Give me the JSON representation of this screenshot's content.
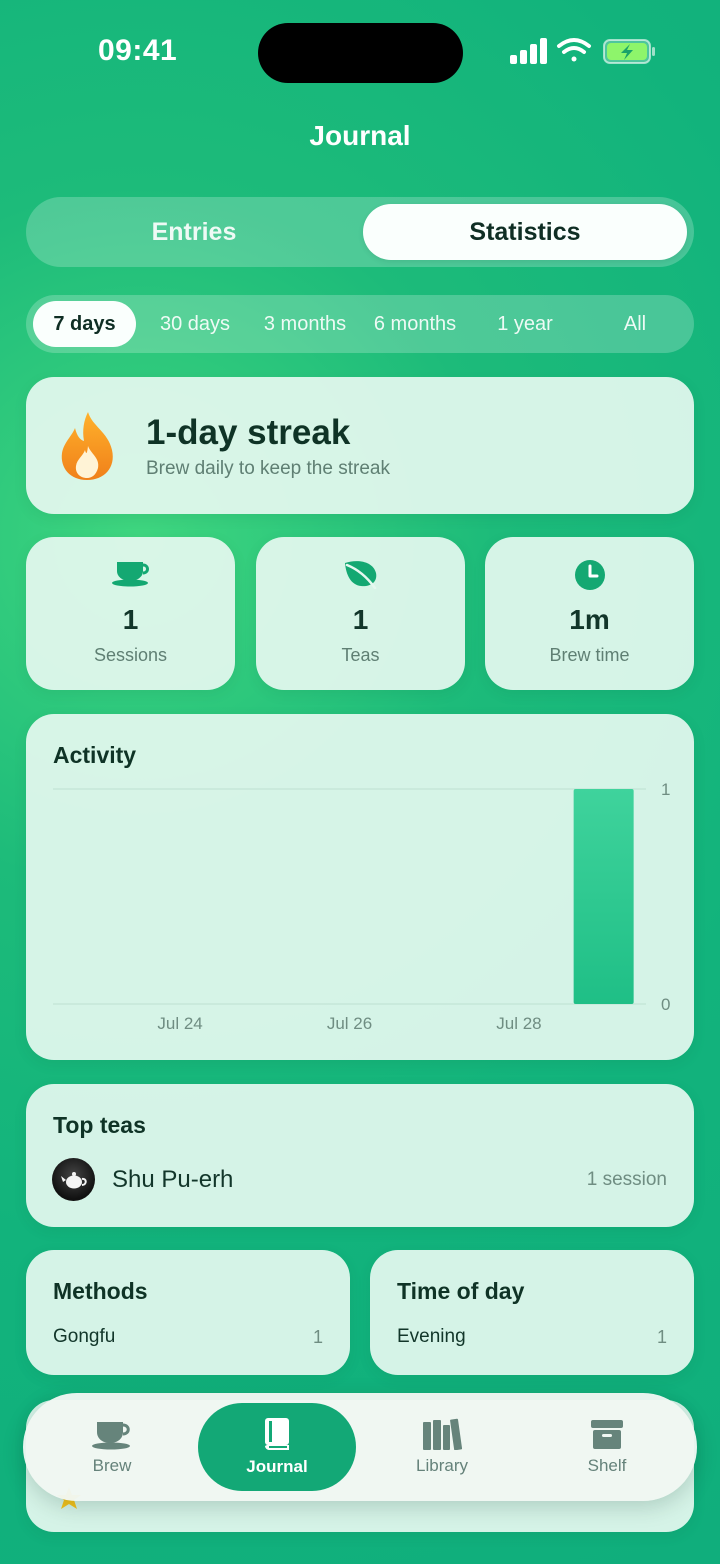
{
  "status": {
    "time": "09:41"
  },
  "header": {
    "title": "Journal"
  },
  "segments": {
    "entries": "Entries",
    "statistics": "Statistics",
    "active": "Statistics"
  },
  "ranges": [
    "7 days",
    "30 days",
    "3 months",
    "6 months",
    "1 year",
    "All"
  ],
  "active_range": "7 days",
  "streak": {
    "title": "1-day streak",
    "subtitle": "Brew daily to keep the streak"
  },
  "stats": [
    {
      "icon": "teacup-icon",
      "value": "1",
      "label": "Sessions"
    },
    {
      "icon": "leaf-icon",
      "value": "1",
      "label": "Teas"
    },
    {
      "icon": "clock-icon",
      "value": "1m",
      "label": "Brew time"
    }
  ],
  "activity": {
    "title": "Activity",
    "chart_data": {
      "type": "bar",
      "x_tick_labels": [
        "Jul 24",
        "Jul 26",
        "Jul 28"
      ],
      "categories": [
        "Jul 23",
        "Jul 24",
        "Jul 25",
        "Jul 26",
        "Jul 27",
        "Jul 28",
        "Jul 29"
      ],
      "values": [
        0,
        0,
        0,
        0,
        0,
        0,
        1
      ],
      "ylim": [
        0,
        1
      ],
      "y_tick_labels": [
        "1",
        "0"
      ],
      "color": "#1fbf86",
      "grid": true
    }
  },
  "top_teas": {
    "title": "Top teas",
    "items": [
      {
        "name": "Shu Pu-erh",
        "count": "1 session"
      }
    ]
  },
  "methods": {
    "title": "Methods",
    "items": [
      {
        "label": "Gongfu",
        "value": "1"
      }
    ]
  },
  "time_of_day": {
    "title": "Time of day",
    "items": [
      {
        "label": "Evening",
        "value": "1"
      }
    ]
  },
  "tabbar": {
    "tabs": [
      {
        "label": "Brew",
        "icon": "teacup-icon"
      },
      {
        "label": "Journal",
        "icon": "book-icon"
      },
      {
        "label": "Library",
        "icon": "books-icon"
      },
      {
        "label": "Shelf",
        "icon": "archive-box-icon"
      }
    ],
    "active": "Journal"
  },
  "colors": {
    "accent": "#13a876",
    "background": "#12b37c",
    "flame": "#f59a1b"
  }
}
